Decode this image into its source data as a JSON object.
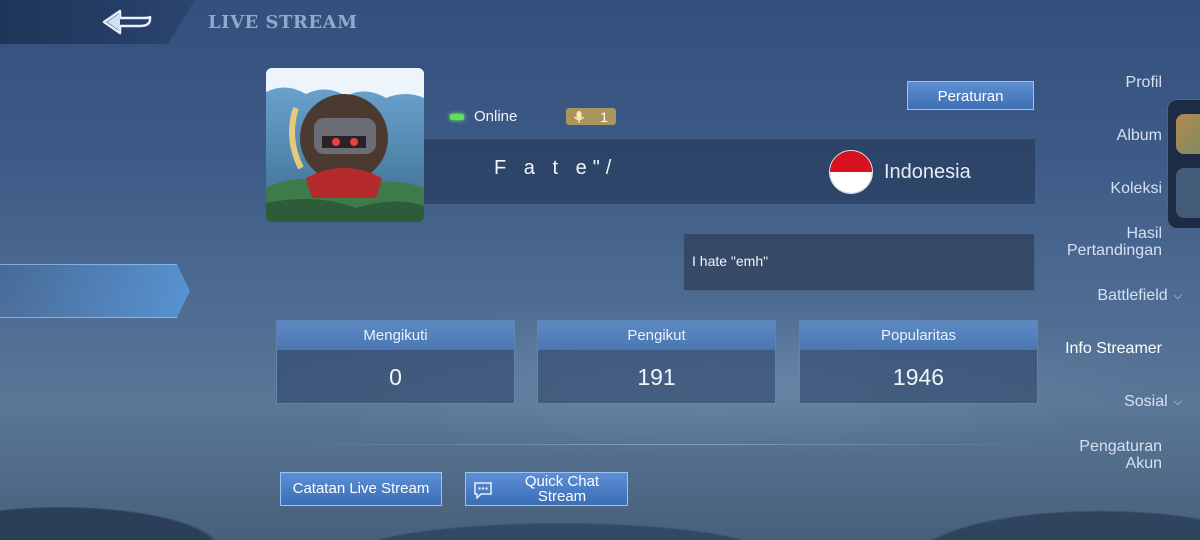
{
  "header": {
    "title": "LIVE STREAM"
  },
  "sidebar": {
    "items": [
      {
        "label": "Profil"
      },
      {
        "label": "Album"
      },
      {
        "label": "Koleksi"
      },
      {
        "label": "Hasil\nPertandingan"
      },
      {
        "label": "Battlefield"
      },
      {
        "label": "Info Streamer"
      },
      {
        "label": "Sosial"
      },
      {
        "label": "Pengaturan\nAkun"
      }
    ],
    "active": "Info Streamer"
  },
  "profile": {
    "status": "Online",
    "mic_count": "1",
    "name": "F a t e\"/",
    "country": "Indonesia",
    "bio": "I hate \"emh\""
  },
  "rules_button": "Peraturan",
  "stats": [
    {
      "label": "Mengikuti",
      "value": "0"
    },
    {
      "label": "Pengikut",
      "value": "191"
    },
    {
      "label": "Popularitas",
      "value": "1946"
    }
  ],
  "actions": {
    "live_log": "Catatan Live Stream",
    "quick_chat": "Quick Chat\nStream"
  },
  "colors": {
    "accent": "#4a7bc0",
    "online": "#5fe05a",
    "flag_red": "#d8121e"
  }
}
